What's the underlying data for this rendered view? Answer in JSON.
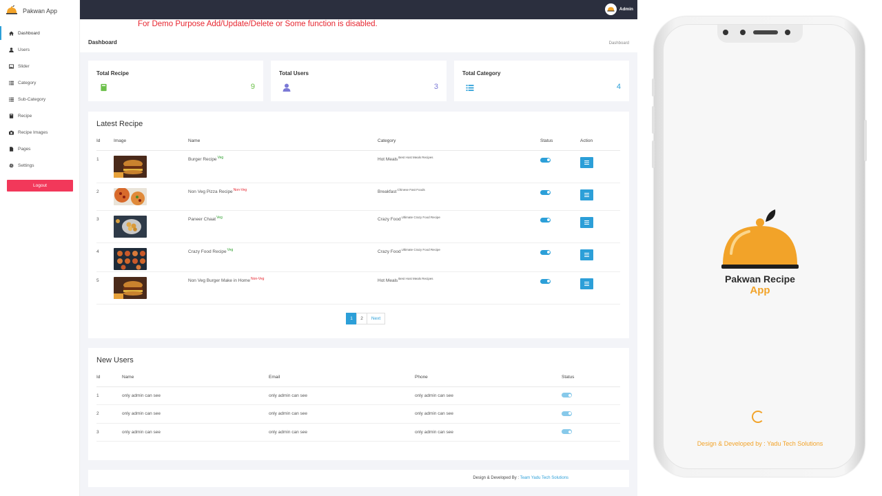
{
  "app": {
    "name": "Pakwan App"
  },
  "sidebar": {
    "items": [
      {
        "label": "Dashboard",
        "icon": "home-icon",
        "active": true
      },
      {
        "label": "Users",
        "icon": "user-icon"
      },
      {
        "label": "Slider",
        "icon": "image-icon"
      },
      {
        "label": "Category",
        "icon": "list-icon"
      },
      {
        "label": "Sub-Category",
        "icon": "list-icon"
      },
      {
        "label": "Recipe",
        "icon": "book-icon"
      },
      {
        "label": "Recipe Images",
        "icon": "camera-icon"
      },
      {
        "label": "Pages",
        "icon": "file-icon"
      },
      {
        "label": "Settings",
        "icon": "gear-icon"
      }
    ],
    "logout_label": "Logout"
  },
  "topbar": {
    "user": "Admin"
  },
  "notice": "For Demo Purpose Add/Update/Delete or Some function is disabled.",
  "page": {
    "title": "Dashboard",
    "breadcrumb": "Dashboard"
  },
  "stats": [
    {
      "title": "Total Recipe",
      "value": "9",
      "color": "#6cc04a",
      "icon": "book-icon"
    },
    {
      "title": "Total Users",
      "value": "3",
      "color": "#7b79d6",
      "icon": "user-icon"
    },
    {
      "title": "Total Category",
      "value": "4",
      "color": "#2c9fd8",
      "icon": "list-icon"
    }
  ],
  "latest_recipe": {
    "title": "Latest Recipe",
    "columns": [
      "Id",
      "Image",
      "Name",
      "Category",
      "Status",
      "Action"
    ],
    "rows": [
      {
        "id": "1",
        "name": "Burger Recipe",
        "tag": "Veg",
        "category": "Hot Meals",
        "sub": "Best Host Meals Recipes",
        "image": "burger"
      },
      {
        "id": "2",
        "name": "Non Veg Pizza Recipe",
        "tag": "Non-Veg",
        "category": "Breakfast",
        "sub": "Chinese Fast Foods",
        "image": "pizza"
      },
      {
        "id": "3",
        "name": "Paneer Chaat",
        "tag": "Veg",
        "category": "Crazy Food",
        "sub": "Ultimate Crazy Food Recipe",
        "image": "chaat"
      },
      {
        "id": "4",
        "name": "Crazy Food Recipe",
        "tag": "Veg",
        "category": "Crazy Food",
        "sub": "Ultimate Crazy Food Recipe",
        "image": "tarts"
      },
      {
        "id": "5",
        "name": "Non Veg Burger Make in Home",
        "tag": "Non-Veg",
        "category": "Hot Meals",
        "sub": "Best Host Meals Recipes",
        "image": "burger"
      }
    ],
    "pagination": {
      "pages": [
        "1",
        "2"
      ],
      "next": "Next",
      "current": "1"
    }
  },
  "new_users": {
    "title": "New Users",
    "columns": [
      "Id",
      "Name",
      "Email",
      "Phone",
      "Status"
    ],
    "rows": [
      {
        "id": "1",
        "name": "only admin can see",
        "email": "only admin can see",
        "phone": "only admin can see"
      },
      {
        "id": "2",
        "name": "only admin can see",
        "email": "only admin can see",
        "phone": "only admin can see"
      },
      {
        "id": "3",
        "name": "only admin can see",
        "email": "only admin can see",
        "phone": "only admin can see"
      }
    ]
  },
  "footer": {
    "prefix": "Design & Developed By :",
    "link": "Team Yadu Tech Solutions"
  },
  "phone": {
    "app_title_1a": "Pakwan",
    "app_title_1b": "Recipe",
    "app_title_2": "App",
    "developer": "Design & Developed by : Yadu Tech Solutions"
  },
  "colors": {
    "accent": "#2c9fd8",
    "brand_orange": "#f2a329",
    "logout": "#f2385a",
    "topbar": "#2b2f3e",
    "notice": "#e6242e"
  }
}
